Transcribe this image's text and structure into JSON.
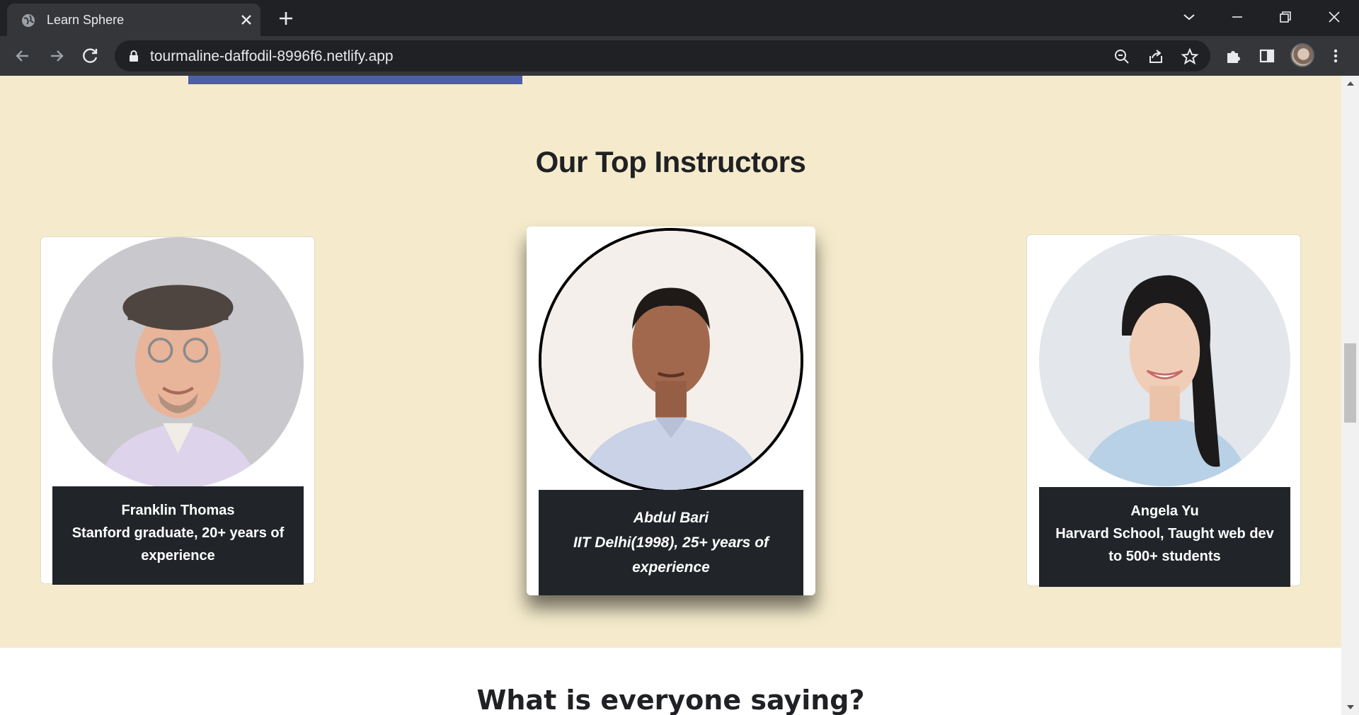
{
  "browser": {
    "tab_title": "Learn Sphere",
    "url": "tourmaline-daffodil-8996f6.netlify.app"
  },
  "page": {
    "section_title": "Our Top Instructors",
    "instructors": [
      {
        "name": "Franklin Thomas",
        "description": "Stanford graduate, 20+ years of experience"
      },
      {
        "name": "Abdul Bari",
        "description": "IIT Delhi(1998), 25+ years of experience"
      },
      {
        "name": "Angela Yu",
        "description": "Harvard School, Taught web dev to 500+ students"
      }
    ],
    "testimonials_title": "What is everyone saying?"
  },
  "colors": {
    "page_background": "#f5ebcc",
    "caption_background": "#212529",
    "accent_strip": "#4c5fa8"
  }
}
